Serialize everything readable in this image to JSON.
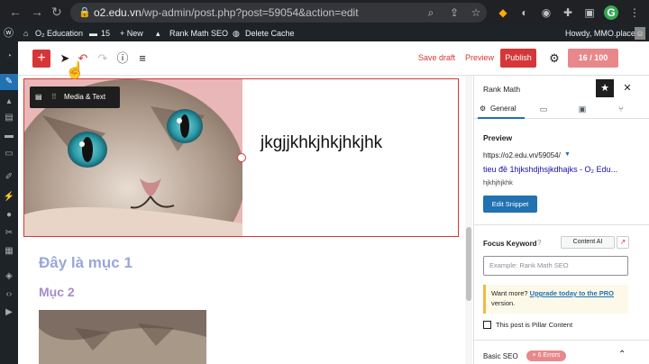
{
  "browser": {
    "url_host": "o2.edu.vn",
    "url_path": "/wp-admin/post.php?post=59054&action=edit",
    "back": "←",
    "forward": "→",
    "reload": "↻",
    "profile": "G"
  },
  "admin_bar": {
    "site_name": "O₂ Education",
    "comments_count": "15",
    "new_label": "+ New",
    "rank_math": "Rank Math SEO",
    "delete_cache": "Delete Cache",
    "greeting": "Howdy, MMO.place"
  },
  "toolbar": {
    "add": "+",
    "save_draft": "Save draft",
    "preview": "Preview",
    "publish": "Publish",
    "score": "16 / 100"
  },
  "canvas": {
    "block_name": "Media & Text",
    "media_text": "jkgjjkhkjhkjhkjhk",
    "heading1": "Đây là mục 1",
    "heading2": "Mục 2"
  },
  "sidebar": {
    "title": "Rank Math",
    "tab_general": "General",
    "preview_title": "Preview",
    "url": "https://o2.edu.vn/59054/",
    "snippet_title": "tieu đề 1hjkshdjhsjkdhajks - O₂ Edu...",
    "snippet_desc": "hjkhjhjkhk",
    "edit_snippet": "Edit Snippet",
    "focus_keyword": "Focus Keyword",
    "content_ai": "Content AI",
    "fk_placeholder": "Example: Rank Math SEO",
    "upsell_prefix": "Want more? ",
    "upsell_link": "Upgrade today to the PRO",
    "upsell_suffix": " version.",
    "pillar": "This post is Pillar Content",
    "basic_seo": "Basic SEO",
    "errors": "× 6 Errors"
  },
  "colors": {
    "accent": "#d63638",
    "wp_dark": "#1d2327",
    "link": "#2271b1"
  }
}
